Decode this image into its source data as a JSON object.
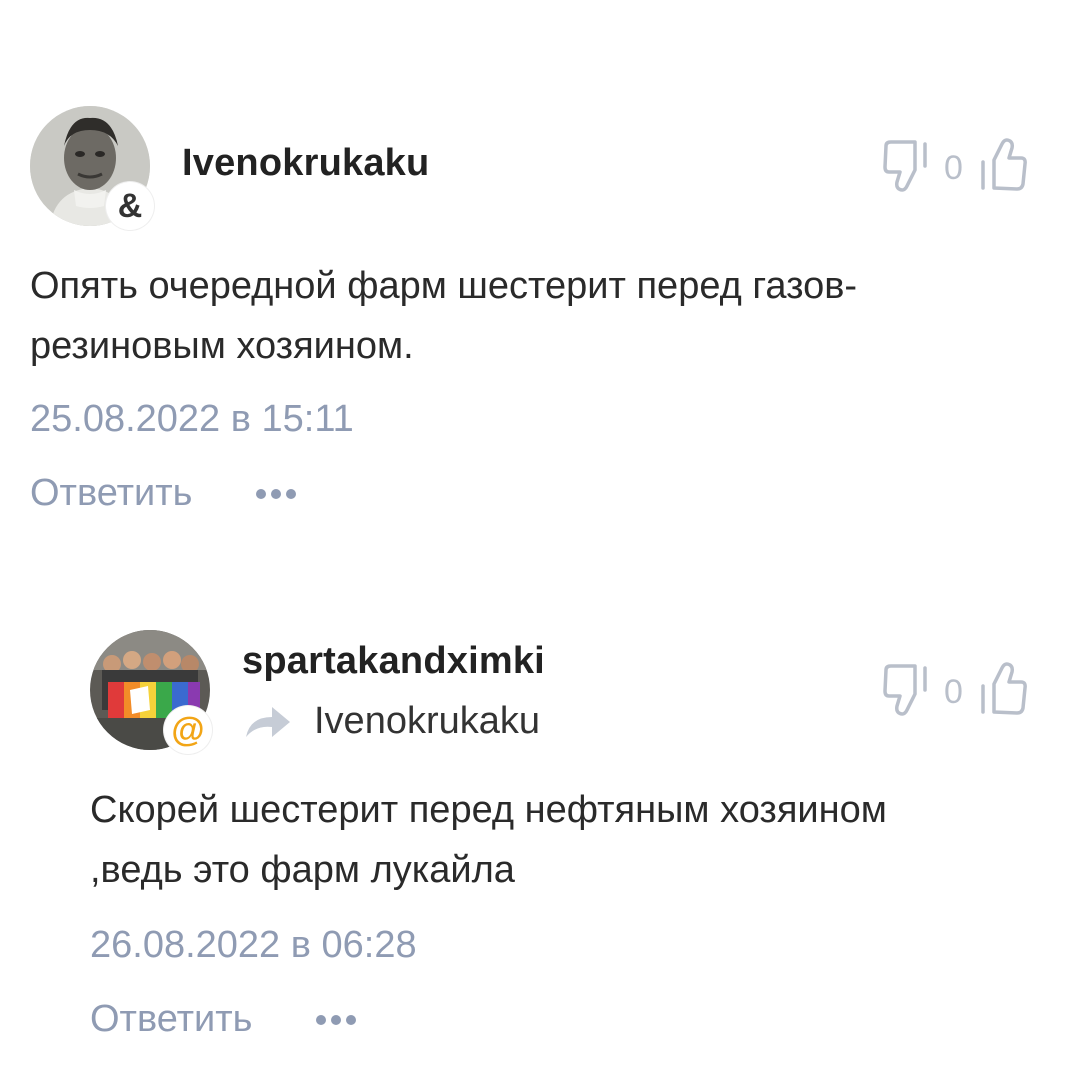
{
  "comments": [
    {
      "username": "Ivenokrukaku",
      "badge": "&",
      "badge_color": "#333333",
      "votes": {
        "count": "0"
      },
      "text_lines": [
        "Опять очередной фарм шестерит перед газов-",
        "резиновым хозяином."
      ],
      "date": "25.08.2022 в 15:11",
      "reply_label": "Ответить"
    },
    {
      "username": "spartakandximki",
      "badge": "@",
      "badge_color": "#f2a516",
      "reply_to": "Ivenokrukaku",
      "votes": {
        "count": "0"
      },
      "text_lines": [
        "Скорей шестерит перед нефтяным хозяином",
        ",ведь это фарм лукайла"
      ],
      "date": "26.08.2022 в 06:28",
      "reply_label": "Ответить"
    }
  ],
  "icons": {
    "dislike": "thumbs-down-icon",
    "like": "thumbs-up-icon",
    "more": "more-dots-icon",
    "reply_arrow": "reply-arrow-icon"
  },
  "colors": {
    "meta": "#8f9bb3",
    "vote": "#b9bfca"
  }
}
